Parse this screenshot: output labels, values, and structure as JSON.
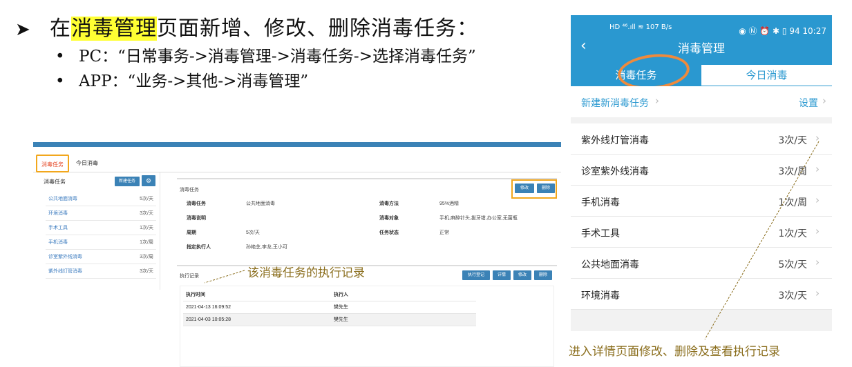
{
  "heading": {
    "arrow": "➤",
    "prefix": "在",
    "highlight": "消毒管理",
    "suffix": "页面新增、修改、删除消毒任务："
  },
  "bullets": [
    "PC：“日常事务->消毒管理->消毒任务->选择消毒任务”",
    "APP：“业务->其他->消毒管理”"
  ],
  "pc": {
    "tabs": {
      "active": "消毒任务",
      "other": "今日消毒"
    },
    "left": {
      "title": "消毒任务",
      "new_button": "新建任务",
      "gear_icon": "gear-icon",
      "items": [
        {
          "name": "公共地面消毒",
          "freq": "5次/天"
        },
        {
          "name": "环境消毒",
          "freq": "3次/天"
        },
        {
          "name": "手术工具",
          "freq": "1次/天"
        },
        {
          "name": "手机消毒",
          "freq": "1次/周"
        },
        {
          "name": "诊室紫外线消毒",
          "freq": "3次/周"
        },
        {
          "name": "紫外线灯管消毒",
          "freq": "3次/天"
        }
      ]
    },
    "detail": {
      "title": "消毒任务",
      "edit": "修改",
      "delete": "删除",
      "fields": {
        "task_label": "消毒任务",
        "task_value": "公共地面消毒",
        "desc_label": "消毒说明",
        "desc_value": "",
        "cycle_label": "周期",
        "cycle_value": "5次/天",
        "exec_label": "指定执行人",
        "exec_value": "孙艳芝,李龙,王小可",
        "method_label": "消毒方法",
        "method_value": "95%酒精",
        "target_label": "消毒对象",
        "target_value": "手机,麻醉针头,拔牙钳,办公室,无菌瓶",
        "status_label": "任务状态",
        "status_value": "正常"
      }
    },
    "records": {
      "title": "执行记录",
      "buttons": {
        "register": "执行登记",
        "detail": "详情",
        "edit": "修改",
        "delete": "删除"
      },
      "columns": {
        "time": "执行时间",
        "person": "执行人"
      },
      "rows": [
        {
          "time": "2021-04-13 16:09:52",
          "person": "樊先生"
        },
        {
          "time": "2021-04-03 10:05:28",
          "person": "樊先生"
        }
      ]
    }
  },
  "annotations": {
    "records": "该消毒任务的执行记录",
    "detail": "进入详情页面修改、删除及查看执行记录"
  },
  "phone": {
    "status_left": "HD ⁴⁶.ıll ≋ 107 B/s",
    "status_right": "◉ Ⓝ ⏰ ✱ ▯ 94 10:27",
    "back": "‹",
    "title": "消毒管理",
    "seg_active": "消毒任务",
    "seg_other": "今日消毒",
    "new_task": "新建新消毒任务",
    "settings": "设置",
    "chevron": "›",
    "items": [
      {
        "name": "紫外线灯管消毒",
        "freq": "3次/天"
      },
      {
        "name": "诊室紫外线消毒",
        "freq": "3次/周"
      },
      {
        "name": "手机消毒",
        "freq": "1次/周"
      },
      {
        "name": "手术工具",
        "freq": "1次/天"
      },
      {
        "name": "公共地面消毒",
        "freq": "5次/天"
      },
      {
        "name": "环境消毒",
        "freq": "3次/天"
      }
    ]
  },
  "colors": {
    "highlight": "#ffff33",
    "accent": "#2a98d0",
    "annotation": "#8a6d1c",
    "box": "#f2a71d"
  }
}
